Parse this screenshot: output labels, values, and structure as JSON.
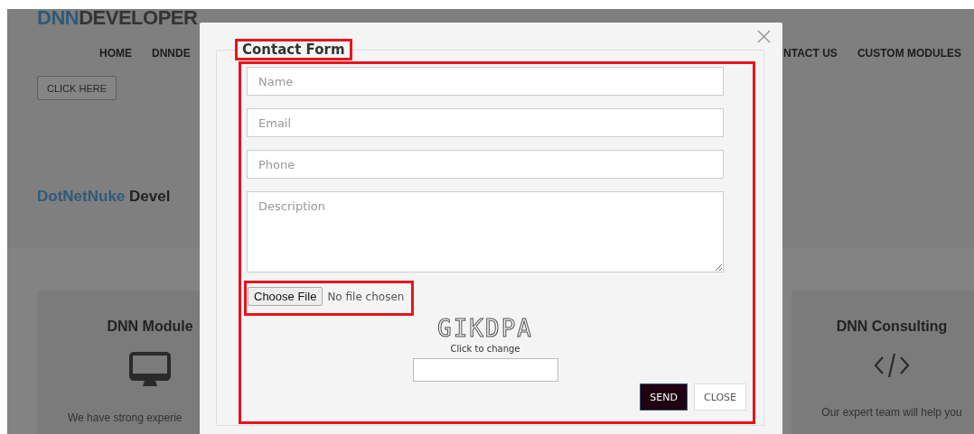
{
  "background_page": {
    "logo": {
      "accent": "DNN",
      "rest": "DEVELOPER"
    },
    "nav": [
      "HOME",
      "DNNDE",
      "NTACT US",
      "CUSTOM MODULES"
    ],
    "button": "CLICK HERE",
    "heading": {
      "accent": "DotNetNuke",
      "rest": "Devel"
    },
    "cards": [
      {
        "kind": "monitor",
        "title": "DNN Module",
        "text": "We have strong experie"
      },
      {
        "kind": "code",
        "title": "DNN Consulting",
        "text": "Our expert team will help you"
      }
    ]
  },
  "modal": {
    "legend": {
      "text": "Contact Form",
      "highlighted": true
    },
    "form_highlighted": true,
    "fields": [
      {
        "kind": "input",
        "placeholder": "Name"
      },
      {
        "kind": "input",
        "placeholder": "Email"
      },
      {
        "kind": "input",
        "placeholder": "Phone"
      },
      {
        "kind": "textarea",
        "placeholder": "Description"
      }
    ],
    "file": {
      "button": "Choose File",
      "status": "No file chosen",
      "highlighted": true
    },
    "captcha": {
      "code": "GIKDPA",
      "hint": "Click to change"
    },
    "buttons": [
      {
        "label": "SEND",
        "primary": true
      },
      {
        "label": "CLOSE",
        "primary": false
      }
    ]
  }
}
